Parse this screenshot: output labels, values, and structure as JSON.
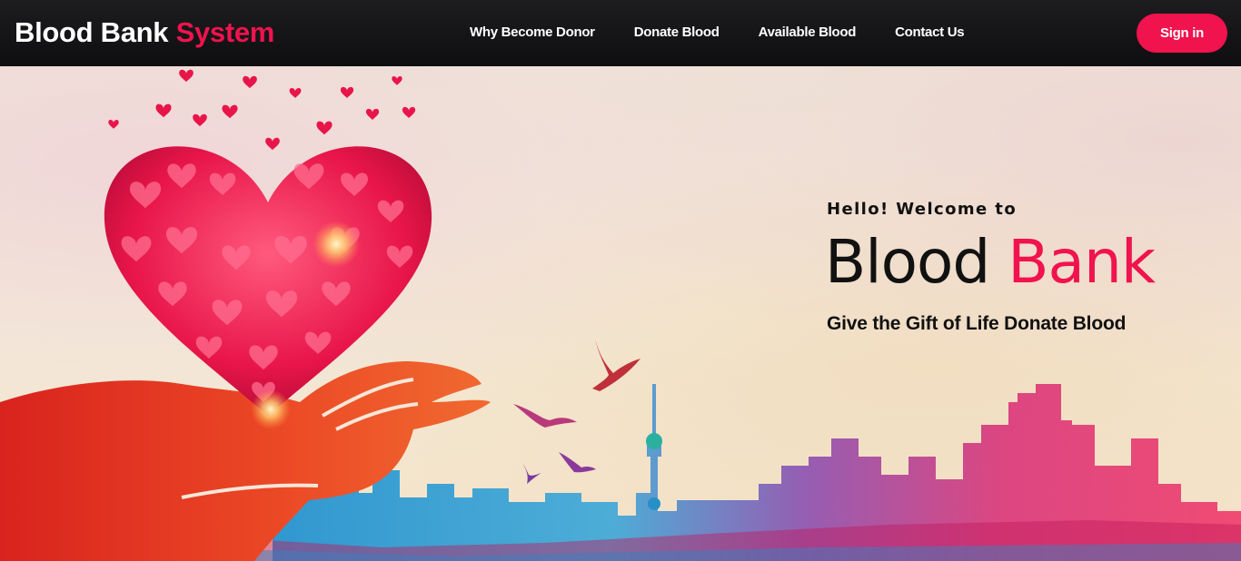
{
  "brand": {
    "part1": "Blood Bank",
    "part2": "System"
  },
  "nav": {
    "links": [
      "Why Become Donor",
      "Donate Blood",
      "Available Blood",
      "Contact Us"
    ],
    "signin_label": "Sign in"
  },
  "hero": {
    "welcome": "Hello! Welcome to",
    "title_part1": "Blood",
    "title_part2": "Bank",
    "tagline": "Give the Gift of Life Donate Blood"
  },
  "colors": {
    "accent": "#f0134d",
    "navbar": "#141416",
    "text": "#111111"
  },
  "icons": [
    "heart-illustration",
    "hand-illustration",
    "birds-illustration",
    "city-skyline-illustration"
  ]
}
